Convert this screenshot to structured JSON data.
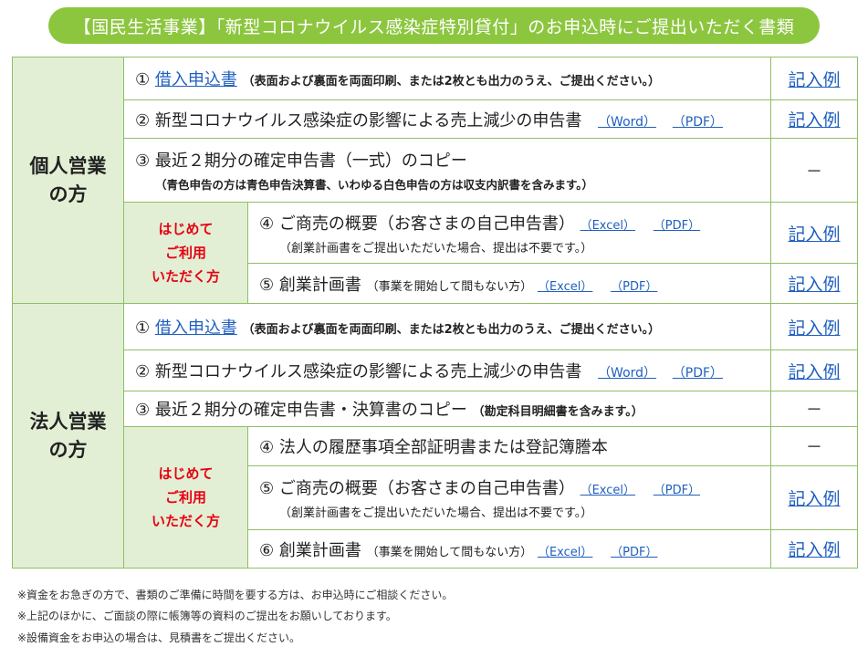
{
  "banner": "【国民生活事業】「新型コロナウイルス感染症特別貸付」のお申込時にご提出いただく書類",
  "first_time_label": [
    "はじめて",
    "ご利用",
    "いただく方"
  ],
  "example_label": "記入例",
  "dash": "－",
  "individual": {
    "title": [
      "個人営業",
      "の方"
    ],
    "d1": {
      "num": "①",
      "link": "借入申込書",
      "note": "（表面および裏面を両面印刷、または2枚とも出力のうえ、ご提出ください。）"
    },
    "d2": {
      "text": "② 新型コロナウイルス感染症の影響による売上減少の申告書",
      "word": "（Word）",
      "pdf": "（PDF）"
    },
    "d3": {
      "text": "③ 最近２期分の確定申告書（一式）のコピー",
      "sub": "（青色申告の方は青色申告決算書、いわゆる白色申告の方は収支内訳書を含みます。）"
    },
    "d4": {
      "text": "④ ご商売の概要（お客さまの自己申告書）",
      "excel": "（Excel）",
      "pdf": "（PDF）",
      "note": "（創業計画書をご提出いただいた場合、提出は不要です。）"
    },
    "d5": {
      "text": "⑤ 創業計画書",
      "note": "（事業を開始して間もない方）",
      "excel": "（Excel）",
      "pdf": "（PDF）"
    }
  },
  "corporate": {
    "title": [
      "法人営業",
      "の方"
    ],
    "d1": {
      "num": "①",
      "link": "借入申込書",
      "note": "（表面および裏面を両面印刷、または2枚とも出力のうえ、ご提出ください。）"
    },
    "d2": {
      "text": "② 新型コロナウイルス感染症の影響による売上減少の申告書",
      "word": "（Word）",
      "pdf": "（PDF）"
    },
    "d3": {
      "text": "③ 最近２期分の確定申告書・決算書のコピー",
      "note": "（勘定科目明細書を含みます。）"
    },
    "d4": {
      "text": "④ 法人の履歴事項全部証明書または登記簿謄本"
    },
    "d5": {
      "text": "⑤ ご商売の概要（お客さまの自己申告書）",
      "excel": "（Excel）",
      "pdf": "（PDF）",
      "note": "（創業計画書をご提出いただいた場合、提出は不要です。）"
    },
    "d6": {
      "text": "⑥ 創業計画書",
      "note": "（事業を開始して間もない方）",
      "excel": "（Excel）",
      "pdf": "（PDF）"
    }
  },
  "footnotes": [
    "※資金をお急ぎの方で、書類のご準備に時間を要する方は、お申込時にご相談ください。",
    "※上記のほかに、ご面談の際に帳簿等の資料のご提出をお願いしております。",
    "※設備資金をお申込の場合は、見積書をご提出ください。"
  ]
}
